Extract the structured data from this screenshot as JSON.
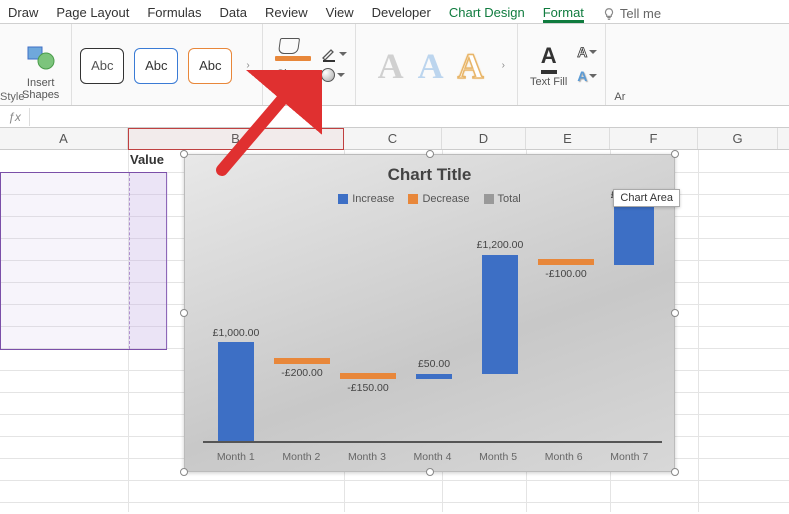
{
  "tabs": {
    "draw": "Draw",
    "page_layout": "Page Layout",
    "formulas": "Formulas",
    "data": "Data",
    "review": "Review",
    "view": "View",
    "developer": "Developer",
    "chart_design": "Chart Design",
    "format": "Format",
    "tell_me": "Tell me"
  },
  "ribbon": {
    "left_truncated": "Style",
    "insert_shapes": "Insert\nShapes",
    "abc": "Abc",
    "shape_fill": "Shape\nFill",
    "text_fill": "Text Fill",
    "wordart_A": "A",
    "right_truncated": "Ar"
  },
  "sheet": {
    "value_header": "Value",
    "columns": [
      "A",
      "B",
      "C",
      "D",
      "E",
      "F",
      "G"
    ]
  },
  "chart_tooltip": "Chart Area",
  "chart_data": {
    "type": "waterfall",
    "title": "Chart Title",
    "legend": [
      "Increase",
      "Decrease",
      "Total"
    ],
    "categories": [
      "Month 1",
      "Month 2",
      "Month 3",
      "Month 4",
      "Month 5",
      "Month 6",
      "Month 7"
    ],
    "values": [
      1000.0,
      -200.0,
      -150.0,
      50.0,
      1200.0,
      -100.0,
      1100.0
    ],
    "labels": [
      "£1,000.00",
      "-£200.00",
      "-£150.00",
      "£50.00",
      "£1,200.00",
      "-£100.00",
      "£1,100.00"
    ],
    "ylim": [
      0,
      2200
    ],
    "colors": {
      "increase": "#3d6fc5",
      "decrease": "#e8873a",
      "total": "#999999"
    }
  }
}
